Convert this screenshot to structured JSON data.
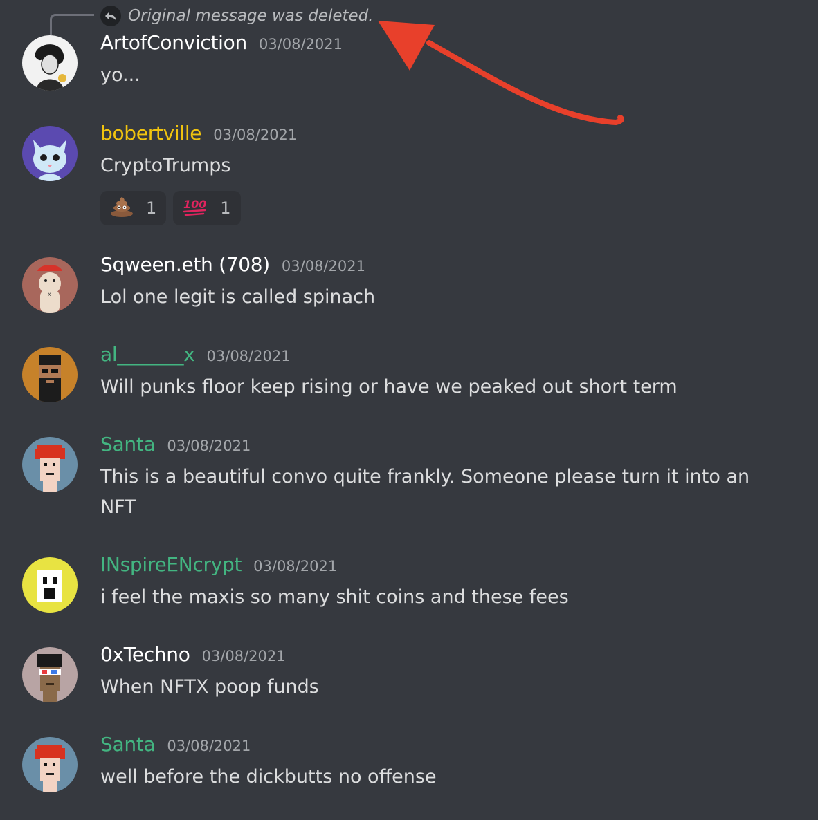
{
  "reply_preview": {
    "text": "Original message was deleted."
  },
  "messages": [
    {
      "username": "ArtofConviction",
      "timestamp": "03/08/2021",
      "content": "yo...",
      "name_color": "#ffffff"
    },
    {
      "username": "bobertville",
      "timestamp": "03/08/2021",
      "content": "CryptoTrumps",
      "name_color": "#f1c40f",
      "reactions": [
        {
          "emoji": "poop-emoji",
          "count": "1"
        },
        {
          "emoji": "hundred-points-emoji",
          "count": "1"
        }
      ]
    },
    {
      "username": "Sqween.eth (708)",
      "timestamp": "03/08/2021",
      "content": "Lol one legit is called spinach",
      "name_color": "#ffffff"
    },
    {
      "username": "al_______x",
      "timestamp": "03/08/2021",
      "content": "Will punks floor keep rising or have we peaked out short term",
      "name_color": "#43b581"
    },
    {
      "username": "Santa",
      "timestamp": "03/08/2021",
      "content": "This is a beautiful convo quite frankly. Someone please turn it into an NFT",
      "name_color": "#43b581"
    },
    {
      "username": "INspireENcrypt",
      "timestamp": "03/08/2021",
      "content": "i feel the maxis so many shit coins and these fees",
      "name_color": "#43b581"
    },
    {
      "username": "0xTechno",
      "timestamp": "03/08/2021",
      "content": "When NFTX poop funds",
      "name_color": "#ffffff"
    },
    {
      "username": "Santa",
      "timestamp": "03/08/2021",
      "content": "well before the dickbutts no offense",
      "name_color": "#43b581"
    }
  ]
}
